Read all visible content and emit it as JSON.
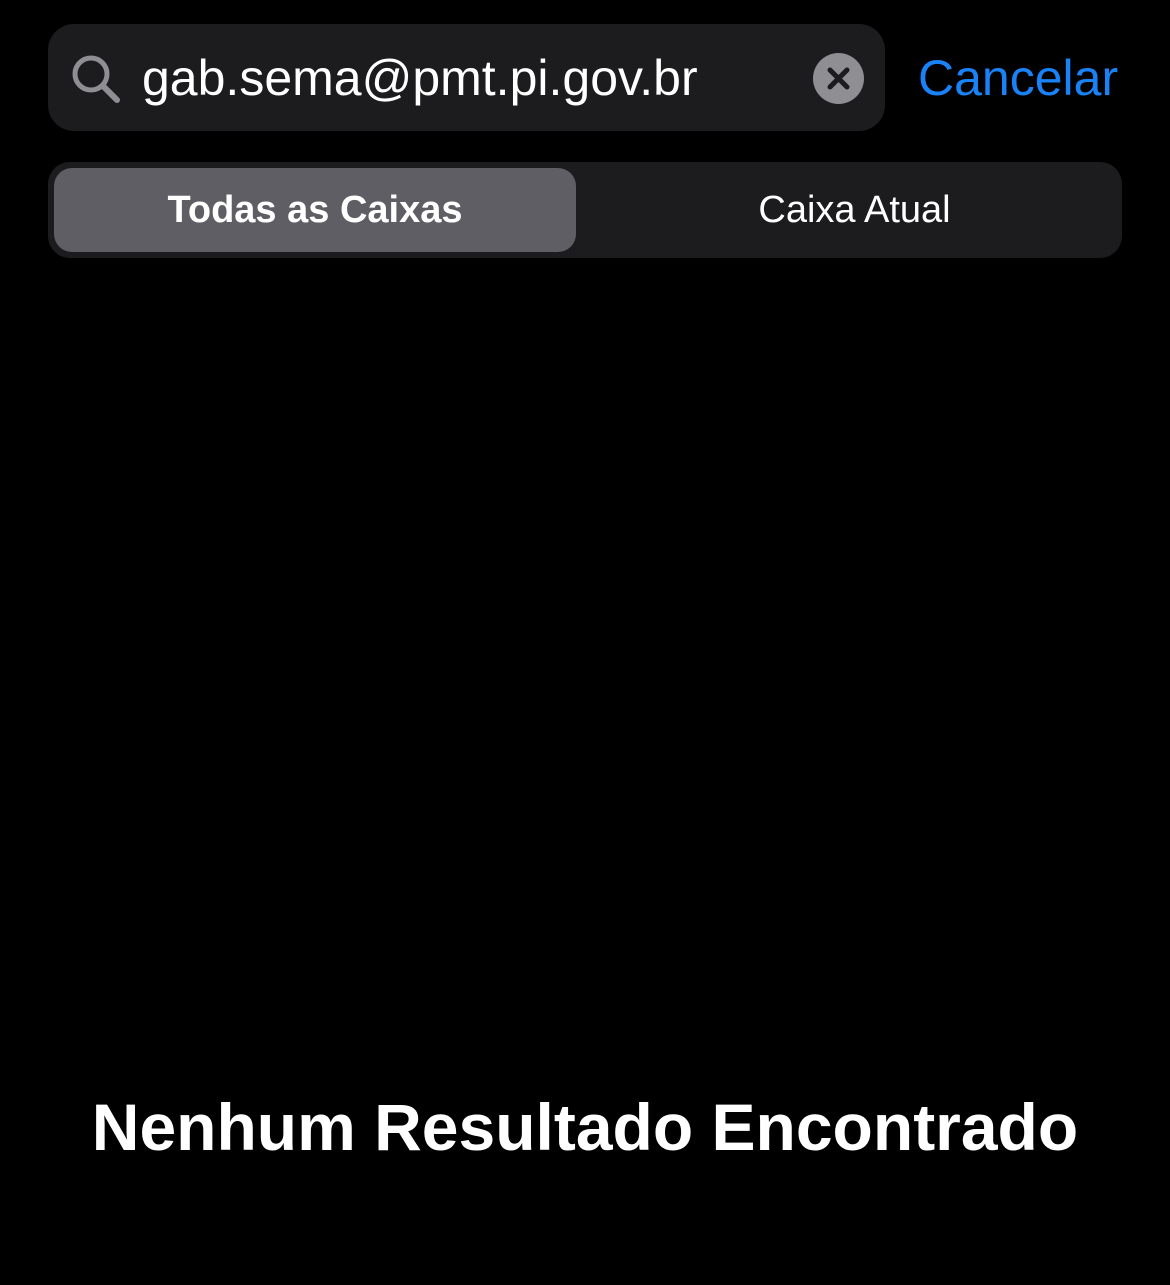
{
  "search": {
    "value": "gab.sema@pmt.pi.gov.br",
    "search_icon": "magnifying-glass-icon",
    "clear_icon": "xmark-circle-fill-icon",
    "cancel_label": "Cancelar"
  },
  "scope": {
    "segments": [
      {
        "label": "Todas as Caixas",
        "selected": true
      },
      {
        "label": "Caixa Atual",
        "selected": false
      }
    ]
  },
  "results": {
    "empty_message": "Nenhum Resultado Encontrado"
  },
  "colors": {
    "background": "#000000",
    "field_background": "#1c1c1e",
    "selected_segment": "#5e5e64",
    "accent": "#1a82f7",
    "icon_gray": "#8e8e93"
  }
}
